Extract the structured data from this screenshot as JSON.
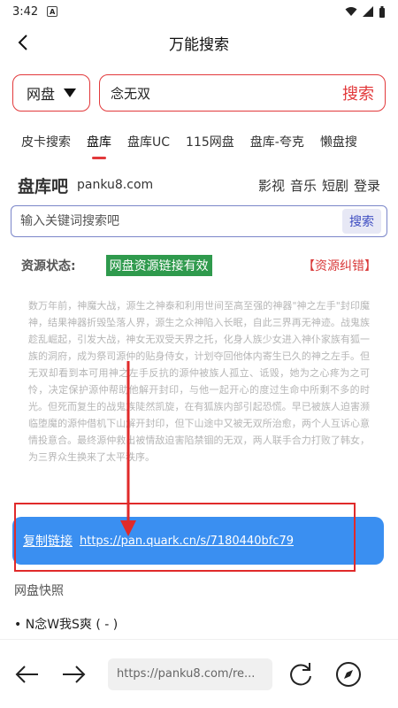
{
  "status_bar": {
    "time": "3:42",
    "notification_icon": "A"
  },
  "header": {
    "title": "万能搜索"
  },
  "search": {
    "engine": "网盘",
    "query": "念无双",
    "button": "搜索"
  },
  "tabs": [
    {
      "label": "皮卡搜索",
      "active": false
    },
    {
      "label": "盘库",
      "active": true
    },
    {
      "label": "盘库UC",
      "active": false
    },
    {
      "label": "115网盘",
      "active": false
    },
    {
      "label": "盘库-夸克",
      "active": false
    },
    {
      "label": "懒盘搜",
      "active": false
    }
  ],
  "site": {
    "brand": "盘库吧",
    "domain": "panku8.com",
    "nav": [
      "影视",
      "音乐",
      "短剧",
      "登录"
    ],
    "search_placeholder": "输入关键词搜索吧",
    "search_button": "搜索"
  },
  "resource": {
    "status_label": "资源状态:",
    "status_value": "网盘资源链接有效",
    "report": "【资源纠错】",
    "description": "数万年前，神魔大战，源生之神泰和利用世间至高至强的神器\"神之左手\"封印魔神，结果神器折毁坠落人界，源生之众神陷入长眠，自此三界再无神迹。战鬼族趁乱崛起，引发大战，神女无双受天界之托，化身人族少女进入神仆家族有狐一族的洞府，成为祭司源仲的贴身侍女，计划夺回他体内寄生已久的神之左手。但无双却看到本可用神之左手反抗的源仲被族人孤立、诋毁，她为之心疼为之可怜，决定保护源仲帮助他解开封印，与他一起开心的度过生命中所剩不多的时光。但死而复生的战鬼族陡然凯旋，在有狐族内部引起恐慌。早已被族人迫害濒临堕魔的源仲借机下山解开封印，但下山途中又被无双所治愈，两个人互诉心意情投意合。最终源仲救出被情敌迫害陷禁锢的无双，两人联手合力打败了韩女，为三界众生换来了太平秩序。",
    "copy_label": "复制链接",
    "link_url": "https://pan.quark.cn/s/7180440bfc79"
  },
  "snapshot": {
    "title": "网盘快照",
    "items": [
      "N念W我S爽 ( - )"
    ]
  },
  "browser": {
    "url": "https://panku8.com/re..."
  },
  "colors": {
    "accent_red": "#e2393b",
    "link_blue": "#3a8ff1",
    "valid_green": "#2f9a4d"
  }
}
